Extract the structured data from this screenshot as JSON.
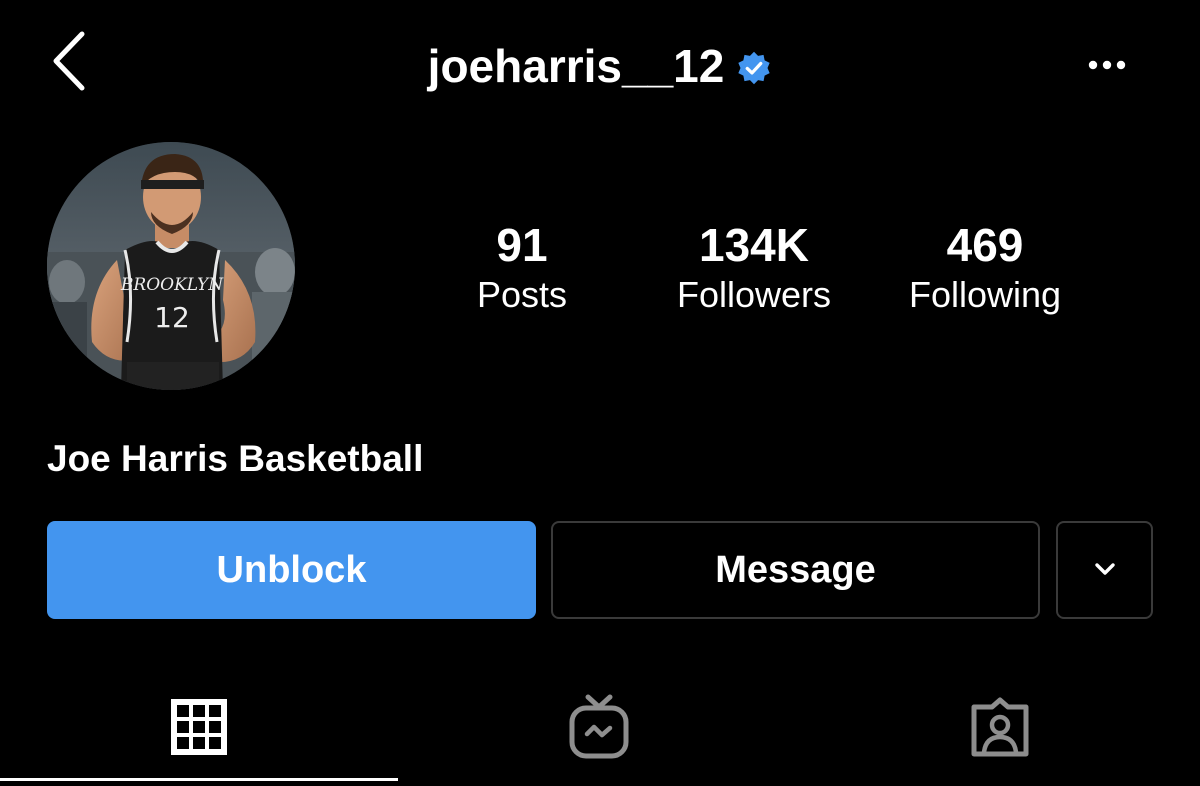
{
  "header": {
    "username": "joeharris__12",
    "verified": true,
    "back_icon": "chevron-left-icon",
    "more_icon": "more-horizontal-icon"
  },
  "profile": {
    "display_name": "Joe Harris Basketball",
    "avatar": {
      "jersey_team": "BROOKLYN",
      "jersey_number": "12"
    }
  },
  "stats": {
    "posts": {
      "count": "91",
      "label": "Posts"
    },
    "followers": {
      "count": "134K",
      "label": "Followers"
    },
    "following": {
      "count": "469",
      "label": "Following"
    }
  },
  "actions": {
    "unblock_label": "Unblock",
    "message_label": "Message",
    "dropdown_icon": "chevron-down-icon"
  },
  "tabs": [
    {
      "icon": "grid-icon",
      "active": true
    },
    {
      "icon": "igtv-icon",
      "active": false
    },
    {
      "icon": "tagged-user-icon",
      "active": false
    }
  ],
  "colors": {
    "background": "#000000",
    "accent": "#4395EF",
    "verified_badge": "#4395EF",
    "border": "#3A3A3A",
    "inactive_icon": "#8E8E8E"
  }
}
